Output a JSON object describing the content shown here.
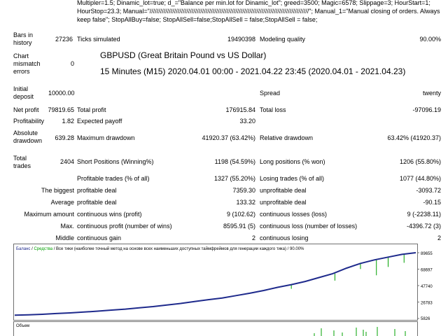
{
  "params_text": "Multipler=1.5; Dinamic_lot=true; d_=\"Balance per min.lot for Dinamic_lot\"; greed=3500; Magic=6578; Slippage=3; HourStart=1; HourStop=23.3; Manual=\"///////////////////////////////////////////////////////////////////////////////////////////\"; Manual_1=\"Manual closing of orders. Always keep false\"; StopAllBuy=false; StopAllSell=false;StopAllSell = false;StopAllSell = false;",
  "report": {
    "bars_label": "Bars in history",
    "bars_value": "27236",
    "ticks_label": "Ticks simulated",
    "ticks_value": "19490398",
    "quality_label": "Modeling quality",
    "quality_value": "90.00%",
    "mismatch_label": "Chart mismatch errors",
    "mismatch_value": "0",
    "symbol": "GBPUSD (Great Britain Pound vs US Dollar)",
    "period": "15 Minutes (M15) 2020.04.01 00:00 - 2021.04.22 23:45 (2020.04.01 - 2021.04.23)",
    "deposit_label": "Initial deposit",
    "deposit_value": "10000.00",
    "spread_label": "Spread",
    "spread_value": "twenty",
    "net_profit_label": "Net profit",
    "net_profit_value": "79819.65",
    "total_profit_label": "Total profit",
    "total_profit_value": "176915.84",
    "total_loss_label": "Total loss",
    "total_loss_value": "-97096.19",
    "profitability_label": "Profitability",
    "profitability_value": "1.82",
    "payoff_label": "Expected payoff",
    "payoff_value": "33.20",
    "abs_dd_label": "Absolute drawdown",
    "abs_dd_value": "639.28",
    "max_dd_label": "Maximum drawdown",
    "max_dd_value": "41920.37 (63.42%)",
    "rel_dd_label": "Relative drawdown",
    "rel_dd_value": "63.42% (41920.37)",
    "total_trades_label": "Total trades",
    "total_trades_value": "2404",
    "short_label": "Short Positions (Winning%)",
    "short_value": "1198 (54.59%)",
    "long_label": "Long positions (% won)",
    "long_value": "1206 (55.80%)",
    "profit_trades_label": "Profitable trades (% of all)",
    "profit_trades_value": "1327 (55.20%)",
    "loss_trades_label": "Losing trades (% of all)",
    "loss_trades_value": "1077 (44.80%)",
    "biggest_label": "The biggest",
    "biggest_profit_label": "profitable deal",
    "biggest_profit_value": "7359.30",
    "biggest_loss_label": "unprofitable deal",
    "biggest_loss_value": "-3093.72",
    "average_label": "Average",
    "average_profit_label": "profitable deal",
    "average_profit_value": "133.32",
    "average_loss_label": "unprofitable deal",
    "average_loss_value": "-90.15",
    "max_amount_label": "Maximum amount",
    "max_wins_label": "continuous wins (profit)",
    "max_wins_value": "9 (102.62)",
    "max_losses_label": "continuous losses (loss)",
    "max_losses_value": "9 (-2238.11)",
    "max_label": "Max.",
    "max_profit_label": "continuous profit (number of wins)",
    "max_profit_value": "8595.91 (5)",
    "max_loss_label": "continuous loss (number of losses)",
    "max_loss_value": "-4396.72 (3)",
    "middle_label": "Middle",
    "middle_gain_label": "continuous gain",
    "middle_gain_value": "2",
    "middle_losing_label": "continuous losing",
    "middle_losing_value": "2"
  },
  "chart_data": {
    "type": "line",
    "legend_balance": "Баланс",
    "legend_equity": "Средства",
    "legend_text": " / Все тики (наиболее точный метод на основе всех наименьших доступных таймфреймов для генерации каждого тика) / 90.00%",
    "y_ticks": [
      "89655",
      "68697",
      "47740",
      "26783",
      "5826"
    ],
    "ylim": [
      5826,
      89655
    ],
    "balance": [
      10000,
      10500,
      11200,
      12200,
      13000,
      14000,
      15200,
      16500,
      17800,
      19500,
      21000,
      23000,
      25000,
      27500,
      29800,
      32000,
      35000,
      38000,
      41500,
      45500,
      49000,
      53000,
      58000,
      63000,
      70000,
      76000,
      80500,
      84000,
      87500,
      89655
    ],
    "balance_color": "#1e2a8c",
    "equity_color": "#00a000",
    "volume_label": "Объем"
  }
}
